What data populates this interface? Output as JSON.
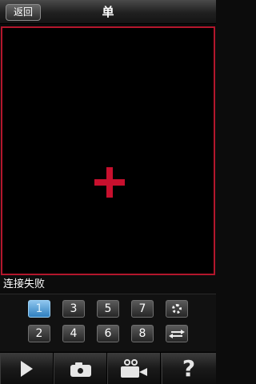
{
  "header": {
    "back_label": "返回",
    "title": "单"
  },
  "status": {
    "text": "连接失败"
  },
  "channels": {
    "row1": [
      "1",
      "3",
      "5",
      "7"
    ],
    "row2": [
      "2",
      "4",
      "6",
      "8"
    ],
    "selected": "1"
  },
  "icons": {
    "video_placeholder": "plus-icon",
    "settings": "gear-icon",
    "switch": "swap-arrows-icon",
    "play": "play-icon",
    "snapshot": "camera-icon",
    "record": "video-camera-icon",
    "help": "help-icon",
    "help_glyph": "?"
  },
  "colors": {
    "frame_border": "#b3162c",
    "plus": "#c8102e",
    "selected_channel": "#4a9ad8"
  }
}
